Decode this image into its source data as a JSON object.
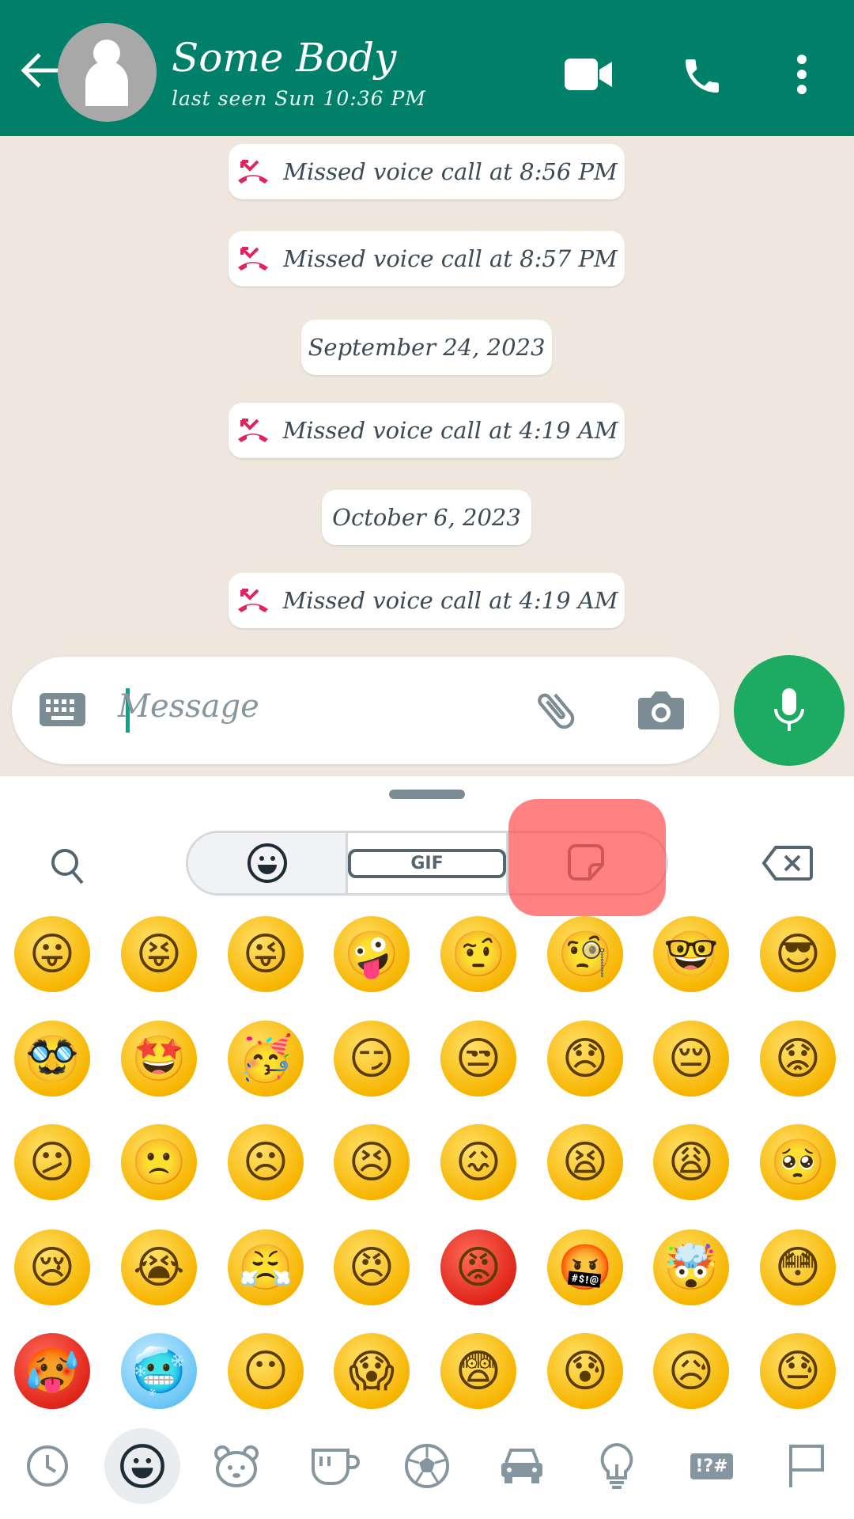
{
  "header": {
    "contact_name": "Some Body",
    "status": "last seen Sun 10:36 PM",
    "icons": [
      "back-arrow-icon",
      "avatar",
      "video-call-icon",
      "voice-call-icon",
      "more-options-icon"
    ],
    "color": "#008069"
  },
  "chat": {
    "items": [
      {
        "type": "missed-call",
        "text": "Missed voice call at 8:56 PM"
      },
      {
        "type": "missed-call",
        "text": "Missed voice call at 8:57 PM"
      },
      {
        "type": "date",
        "text": "September 24, 2023"
      },
      {
        "type": "missed-call",
        "text": "Missed voice call at 4:19 AM"
      },
      {
        "type": "date",
        "text": "October 6, 2023"
      },
      {
        "type": "missed-call",
        "text": "Missed voice call at 4:19 AM"
      }
    ],
    "missed_call_color": "#e0245e"
  },
  "composer": {
    "placeholder": "Message",
    "icons": [
      "keyboard-icon",
      "attach-icon",
      "camera-icon",
      "mic-icon"
    ]
  },
  "emoji_panel": {
    "tabs": [
      {
        "name": "emoji",
        "selected": true
      },
      {
        "name": "gif",
        "label": "GIF"
      },
      {
        "name": "sticker"
      }
    ],
    "rows": [
      [
        "😛",
        "😝",
        "😜",
        "🤪",
        "🤨",
        "🧐",
        "🤓",
        "😎"
      ],
      [
        "🥸",
        "🤩",
        "🥳",
        "😏",
        "😒",
        "😞",
        "😔",
        "😟"
      ],
      [
        "😕",
        "🙁",
        "☹",
        "😣",
        "😖",
        "😫",
        "😩",
        "🥺"
      ],
      [
        "😢",
        "😭",
        "😤",
        "😠",
        "😡",
        "🤬",
        "🤯",
        "😳"
      ],
      [
        "🥵",
        "🥶",
        "😶",
        "😱",
        "😨",
        "😰",
        "😥",
        "😓"
      ]
    ],
    "categories": [
      "recent",
      "smileys",
      "animals",
      "food",
      "activities",
      "travel",
      "objects",
      "symbols",
      "flags"
    ],
    "symbols_label": "!?#"
  }
}
